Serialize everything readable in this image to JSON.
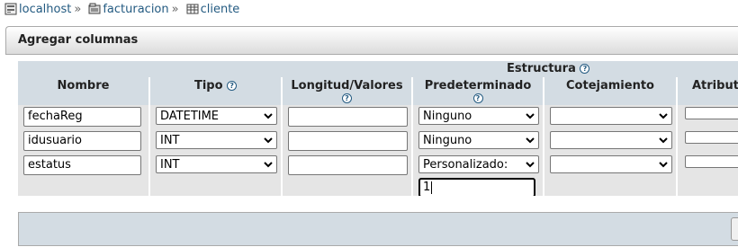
{
  "breadcrumb": {
    "server": "localhost",
    "database": "facturacion",
    "table": "cliente",
    "separator": "»"
  },
  "panel": {
    "title": "Agregar columnas"
  },
  "structure": {
    "title": "Estructura",
    "help_glyph": "?",
    "headers": {
      "name": "Nombre",
      "type": "Tipo",
      "length_values": "Longitud/Valores",
      "default": "Predeterminado",
      "collation": "Cotejamiento",
      "attributes": "Atribut"
    }
  },
  "rows": [
    {
      "name": "fechaReg",
      "type": "DATETIME",
      "length": "",
      "default": "Ninguno",
      "collation": ""
    },
    {
      "name": "idusuario",
      "type": "INT",
      "length": "",
      "default": "Ninguno",
      "collation": ""
    },
    {
      "name": "estatus",
      "type": "INT",
      "length": "",
      "default": "Personalizado:",
      "collation": "",
      "custom_default": "1"
    }
  ],
  "colors": {
    "link": "#235a81",
    "header_bg": "#d3dce3",
    "row_bg": "#e5e5e5"
  }
}
